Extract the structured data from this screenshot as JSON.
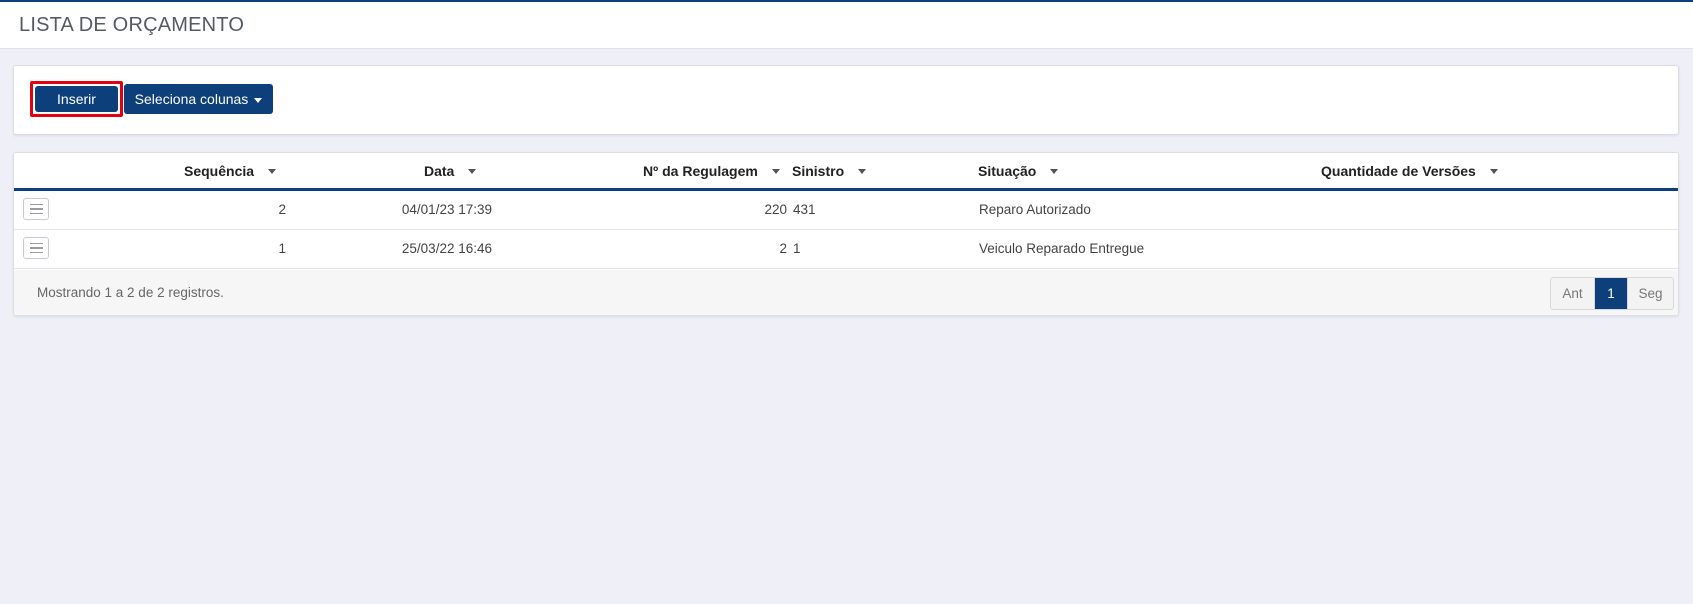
{
  "header": {
    "title": "LISTA DE ORÇAMENTO"
  },
  "toolbar": {
    "insert_label": "Inserir",
    "columns_label": "Seleciona colunas"
  },
  "table": {
    "columns": [
      "Sequência",
      "Data",
      "Nº da Regulagem",
      "Sinistro",
      "Situação",
      "Quantidade de Versões"
    ],
    "rows": [
      {
        "sequencia": "2",
        "data": "04/01/23 17:39",
        "regulagem": "220",
        "sinistro": "431",
        "situacao": "Reparo Autorizado",
        "versoes": ""
      },
      {
        "sequencia": "1",
        "data": "25/03/22 16:46",
        "regulagem": "2",
        "sinistro": "1",
        "situacao": "Veiculo Reparado Entregue",
        "versoes": ""
      }
    ]
  },
  "footer": {
    "info": "Mostrando 1 a 2 de 2 registros.",
    "pagination": {
      "prev": "Ant",
      "current": "1",
      "next": "Seg"
    }
  },
  "colors": {
    "accent": "#0d3f7a",
    "highlight": "#e3000f",
    "background": "#eeeff7"
  }
}
